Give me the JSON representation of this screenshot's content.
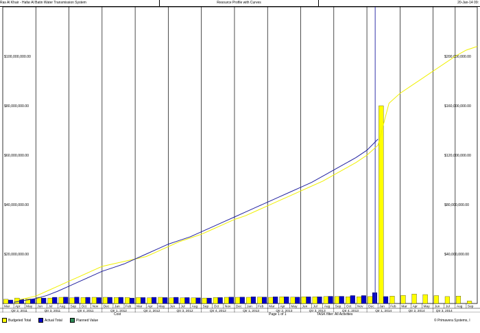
{
  "header": {
    "project": "Ras Al Khair - Hafar Al Batin Water Transmission System",
    "report": "Resource Profile with Curves",
    "date": "20-Jan-14 09:"
  },
  "footer": {
    "cost_label": "Cost",
    "page_label": "Page 1 of 1",
    "filter_label": "TASK filter: All Activities",
    "copyright": "© Primavera Systems, I"
  },
  "legend": [
    {
      "label": "Budgeted Total",
      "color": "#ffff00"
    },
    {
      "label": "Actual Total",
      "color": "#0000c8"
    },
    {
      "label": "Planned Value",
      "color": "#2e8b57"
    }
  ],
  "chart_data": {
    "type": "bar",
    "title": "Resource Profile with Curves",
    "months": [
      "Mar",
      "Apr",
      "May",
      "Jun",
      "Jul",
      "Aug",
      "Sep",
      "Oct",
      "Nov",
      "Dec",
      "Jan",
      "Feb",
      "Mar",
      "Apr",
      "May",
      "Jun",
      "Jul",
      "Aug",
      "Sep",
      "Oct",
      "Nov",
      "Dec",
      "Jan",
      "Feb",
      "Mar",
      "Apr",
      "May",
      "Jun",
      "Jul",
      "Aug",
      "Sep",
      "Oct",
      "Nov",
      "Dec",
      "Jan",
      "Feb",
      "Mar",
      "Apr",
      "May",
      "Jun",
      "Jul",
      "Aug",
      "Sep"
    ],
    "quarters": [
      "Qtr 2, 2011",
      "Qtr 3, 2011",
      "Qtr 4, 2011",
      "Qtr 1, 2012",
      "Qtr 2, 2012",
      "Qtr 3, 2012",
      "Qtr 4, 2012",
      "Qtr 1, 2013",
      "Qtr 2, 2013",
      "Qtr 3, 2013",
      "Qtr 4, 2013",
      "Qtr 1, 2014",
      "Qtr 2, 2014",
      "Qtr 3, 2014"
    ],
    "quarter_month_counts": [
      3,
      3,
      3,
      3,
      3,
      3,
      3,
      3,
      3,
      3,
      3,
      3,
      3,
      2
    ],
    "left_axis": {
      "ticks": [
        "$20,000,000.00",
        "$40,000,000.00",
        "$60,000,000.00",
        "$80,000,000.00",
        "$100,000,000.00"
      ],
      "values": [
        20000000,
        40000000,
        60000000,
        80000000,
        100000000
      ],
      "max": 120000000
    },
    "right_axis": {
      "ticks": [
        "$40,000,000.00",
        "$80,000,000.00",
        "$120,000,000.00",
        "$160,000,000.00",
        "$200,000,000.00"
      ],
      "values": [
        40000000,
        80000000,
        120000000,
        160000000,
        200000000
      ],
      "max": 240000000
    },
    "series": [
      {
        "name": "Budgeted Total",
        "axis": "left",
        "values": [
          1700000,
          2200000,
          1900000,
          2500000,
          2200000,
          2500000,
          2300000,
          2400000,
          2500000,
          2500000,
          2400000,
          2400000,
          2400000,
          2300000,
          2500000,
          2300000,
          2300000,
          2300000,
          2200000,
          2400000,
          2500000,
          2500000,
          2500000,
          2600000,
          2500000,
          2700000,
          2600000,
          2700000,
          2700000,
          2800000,
          2800000,
          2700000,
          2700000,
          2800000,
          80000000,
          3000000,
          3300000,
          3800000,
          3600000,
          3200000,
          2800000,
          3000000,
          1000000
        ]
      },
      {
        "name": "Actual Total",
        "axis": "left",
        "values": [
          1400000,
          1700000,
          1800000,
          2200000,
          2500000,
          2600000,
          2600000,
          2500000,
          2400000,
          2500000,
          2500000,
          2200000,
          2400000,
          2500000,
          2400000,
          2500000,
          2400000,
          2300000,
          2200000,
          2400000,
          2600000,
          2600000,
          2700000,
          2600000,
          2700000,
          2700000,
          2600000,
          2700000,
          2700000,
          2900000,
          2900000,
          3200000,
          3200000,
          4400000,
          2800000
        ]
      },
      {
        "name": "Budgeted Total cumulative",
        "axis": "right",
        "values": [
          2000000,
          4000000,
          6000000,
          10000000,
          14000000,
          18000000,
          22000000,
          26000000,
          30000000,
          32000000,
          34000000,
          36000000,
          38000000,
          42000000,
          46000000,
          50000000,
          53000000,
          56000000,
          60000000,
          64000000,
          68000000,
          71000000,
          75000000,
          79000000,
          83000000,
          87000000,
          91000000,
          95000000,
          99000000,
          104000000,
          109000000,
          114000000,
          120000000,
          128000000,
          162000000,
          170000000,
          176000000,
          182000000,
          188000000,
          194000000,
          200000000,
          205000000,
          208000000
        ]
      },
      {
        "name": "Actual Total cumulative",
        "axis": "right",
        "values": [
          1000000,
          2500000,
          4000000,
          6500000,
          10000000,
          14000000,
          18000000,
          22000000,
          26000000,
          29000000,
          32000000,
          36000000,
          40000000,
          44000000,
          48000000,
          51000000,
          54000000,
          58000000,
          62000000,
          66000000,
          70000000,
          74000000,
          78000000,
          82000000,
          86000000,
          90000000,
          94000000,
          98000000,
          103000000,
          108000000,
          113000000,
          118000000,
          124000000,
          133000000
        ]
      }
    ]
  }
}
